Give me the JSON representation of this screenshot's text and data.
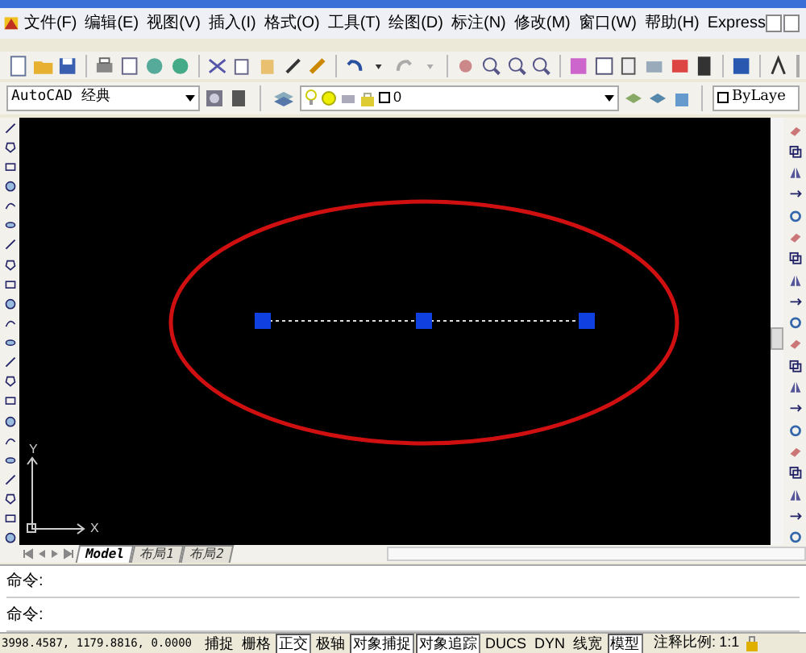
{
  "menu": [
    "文件(F)",
    "编辑(E)",
    "视图(V)",
    "插入(I)",
    "格式(O)",
    "工具(T)",
    "绘图(D)",
    "标注(N)",
    "修改(M)",
    "窗口(W)",
    "帮助(H)",
    "Express"
  ],
  "workspace": {
    "value": "AutoCAD 经典"
  },
  "layer": {
    "value": "0"
  },
  "linetype": {
    "value": "ByLaye"
  },
  "ucs": {
    "x": "X",
    "y": "Y"
  },
  "layout_tabs": [
    {
      "label": "Model",
      "selected": true
    },
    {
      "label": "布局1",
      "selected": false
    },
    {
      "label": "布局2",
      "selected": false
    }
  ],
  "command_lines": [
    "命令:",
    "命令:"
  ],
  "coordinates": "3998.4587, 1179.8816, 0.0000",
  "status_toggles": [
    {
      "label": "捕捉",
      "on": false
    },
    {
      "label": "栅格",
      "on": false
    },
    {
      "label": "正交",
      "on": true
    },
    {
      "label": "极轴",
      "on": false
    },
    {
      "label": "对象捕捉",
      "on": true
    },
    {
      "label": "对象追踪",
      "on": true
    },
    {
      "label": "DUCS",
      "on": false
    },
    {
      "label": "DYN",
      "on": false
    },
    {
      "label": "线宽",
      "on": false
    },
    {
      "label": "模型",
      "on": true
    }
  ],
  "annotation_scale": {
    "label": "注释比例:",
    "value": "1:1"
  }
}
